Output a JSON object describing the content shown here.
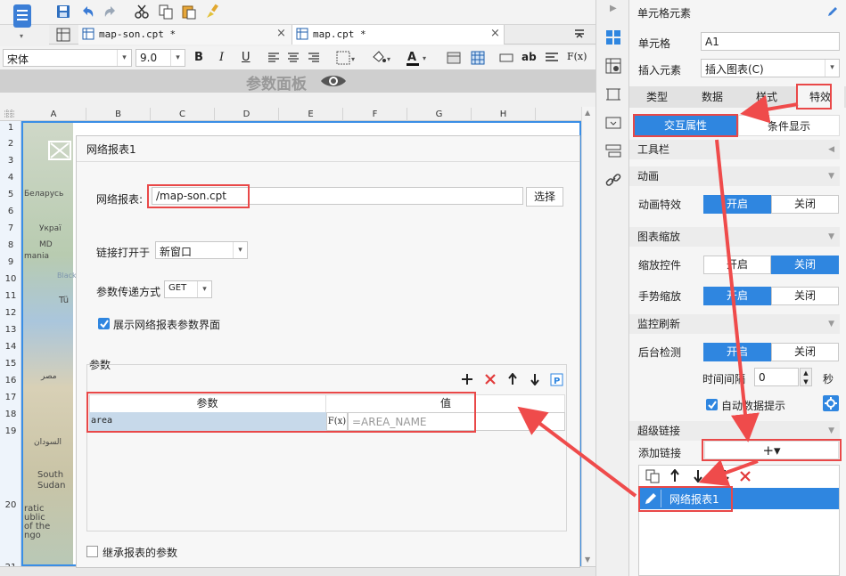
{
  "toolbar": {
    "font_name": "宋体",
    "font_size": "9.0",
    "bold": "B",
    "italic": "I",
    "underline": "U",
    "text_btn": "ab",
    "formula_btn": "F(x)"
  },
  "tabs": [
    {
      "label": "map-son.cpt *",
      "close": "×"
    },
    {
      "label": "map.cpt *",
      "close": "×"
    }
  ],
  "param_panel": {
    "title": "参数面板"
  },
  "columns": [
    "A",
    "B",
    "C",
    "D",
    "E",
    "F",
    "G",
    "H"
  ],
  "rows": [
    "1",
    "2",
    "3",
    "4",
    "5",
    "6",
    "7",
    "8",
    "9",
    "10",
    "11",
    "12",
    "13",
    "14",
    "15",
    "16",
    "17",
    "18",
    "19",
    "20",
    "21"
  ],
  "map_labels": [
    "Беларусь",
    "Украї",
    "MD",
    "mania",
    "Black",
    "Tü",
    "مصر",
    "السودان",
    "South",
    "Sudan",
    "ratic",
    "ublic",
    "of the",
    "ngo"
  ],
  "dialog": {
    "title": "网络报表1",
    "report_label": "网络报表:",
    "report_value": "/map-son.cpt",
    "choose_btn": "选择",
    "link_open_label": "链接打开于",
    "link_open_value": "新窗口",
    "param_method_label": "参数传递方式",
    "param_method_value": "GET",
    "show_params_label": "展示网络报表参数界面",
    "params_group_label": "参数",
    "params_table": {
      "headers": [
        "参数",
        "值"
      ],
      "rows": [
        {
          "param": "area",
          "fx": "F(x)",
          "value": "=AREA_NAME"
        }
      ]
    },
    "inherit_label": "继承报表的参数"
  },
  "right_panel": {
    "header": "单元格元素",
    "cell_label": "单元格",
    "cell_value": "A1",
    "insert_label": "插入元素",
    "insert_value": "插入图表(C)",
    "tabs": [
      "类型",
      "数据",
      "样式",
      "特效"
    ],
    "subtabs": [
      "交互属性",
      "条件显示"
    ],
    "sections": {
      "toolbar": "工具栏",
      "animation": "动画",
      "zoom": "图表缩放",
      "refresh": "监控刷新",
      "hyperlink": "超级链接"
    },
    "anim_effect_label": "动画特效",
    "zoom_ctrl_label": "缩放控件",
    "gesture_label": "手势缩放",
    "bg_detect_label": "后台检测",
    "on": "开启",
    "off": "关闭",
    "interval_label": "时间间隔",
    "interval_value": "0",
    "interval_unit": "秒",
    "auto_tip_label": "自动数据提示",
    "add_link_label": "添加链接",
    "add_link_btn": "+▾",
    "links": [
      "网络报表1"
    ]
  },
  "colors": {
    "accent": "#2f86e0",
    "annotation_red": "#e94848",
    "selected_row": "#2f86e0"
  }
}
